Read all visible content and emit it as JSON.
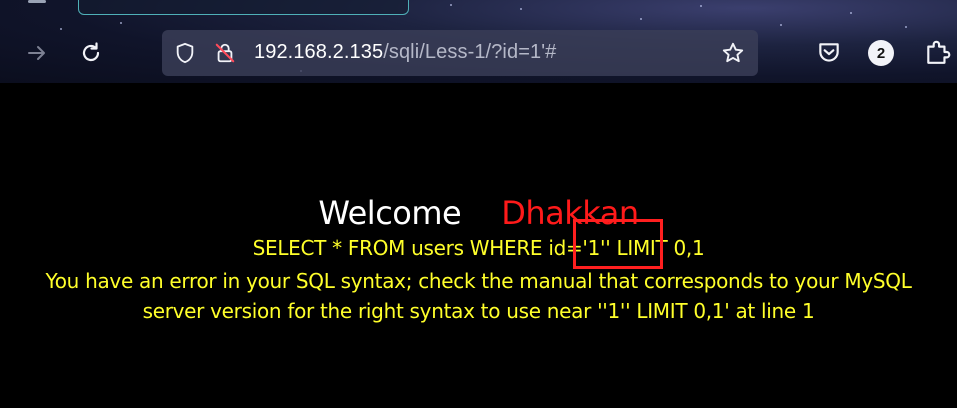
{
  "browser": {
    "url_host": "192.168.2.135",
    "url_path": "/sqli/Less-1/?id=1'#",
    "notification_count": "2",
    "icons": {
      "back": "arrow-right-icon",
      "reload": "reload-icon",
      "shield": "shield-icon",
      "lock": "lock-insecure-icon",
      "bookmark": "star-icon",
      "pocket": "pocket-icon",
      "extensions": "puzzle-icon"
    }
  },
  "page": {
    "welcome": "Welcome",
    "name": "Dhakkan",
    "query": "SELECT * FROM users WHERE id='1'' LIMIT 0,1",
    "error_line1": "You have an error in your SQL syntax; check the manual that corresponds to your MySQL",
    "error_line2": "server version for the right syntax to use near ''1'' LIMIT 0,1' at line 1"
  },
  "colors": {
    "page_background": "#000000",
    "welcome": "#ffffff",
    "name": "#ff1a1a",
    "query_text": "#ffff2a",
    "highlight": "#ff1f1f"
  }
}
